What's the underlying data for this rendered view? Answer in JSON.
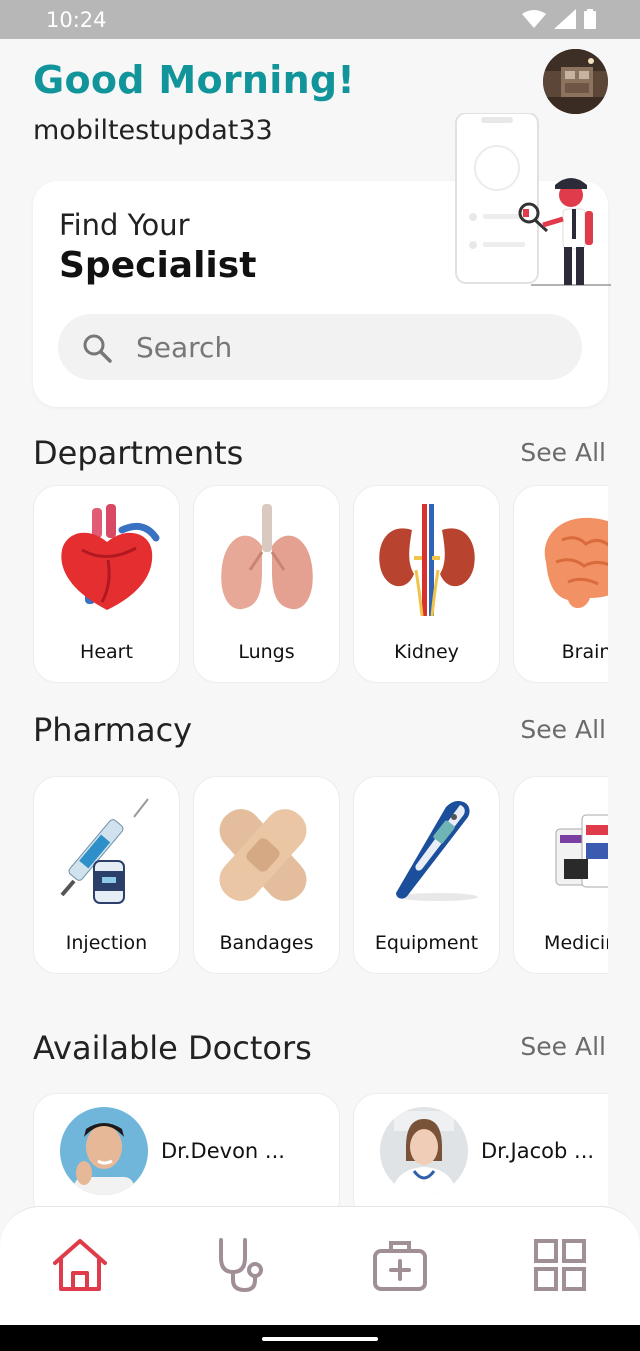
{
  "status_bar": {
    "time": "10:24",
    "icons": [
      "wifi-icon",
      "signal-icon",
      "battery-icon"
    ]
  },
  "header": {
    "greeting": "Good Morning!",
    "username": "mobiltestupdat33"
  },
  "hero": {
    "line1": "Find Your",
    "line2": "Specialist",
    "search_placeholder": "Search"
  },
  "departments": {
    "title": "Departments",
    "see_all": "See All",
    "items": [
      {
        "label": "Heart",
        "icon": "heart-organ-icon"
      },
      {
        "label": "Lungs",
        "icon": "lungs-icon"
      },
      {
        "label": "Kidney",
        "icon": "kidney-icon"
      },
      {
        "label": "Brain",
        "icon": "brain-icon"
      }
    ]
  },
  "pharmacy": {
    "title": "Pharmacy",
    "see_all": "See All",
    "items": [
      {
        "label": "Injection",
        "icon": "injection-icon"
      },
      {
        "label": "Bandages",
        "icon": "bandage-icon"
      },
      {
        "label": "Equipment",
        "icon": "thermometer-icon"
      },
      {
        "label": "Medicine",
        "icon": "medicine-icon"
      }
    ]
  },
  "doctors": {
    "title": "Available Doctors",
    "see_all": "See All",
    "items": [
      {
        "name": "Dr.Devon ..."
      },
      {
        "name": "Dr.Jacob ..."
      }
    ]
  },
  "bottom_nav": {
    "items": [
      "home-icon",
      "stethoscope-icon",
      "medical-kit-icon",
      "grid-icon"
    ],
    "active_color": "#e03b4b",
    "inactive_color": "#a08f97"
  },
  "colors": {
    "accent": "#12959a",
    "background": "#f7f7f7"
  }
}
